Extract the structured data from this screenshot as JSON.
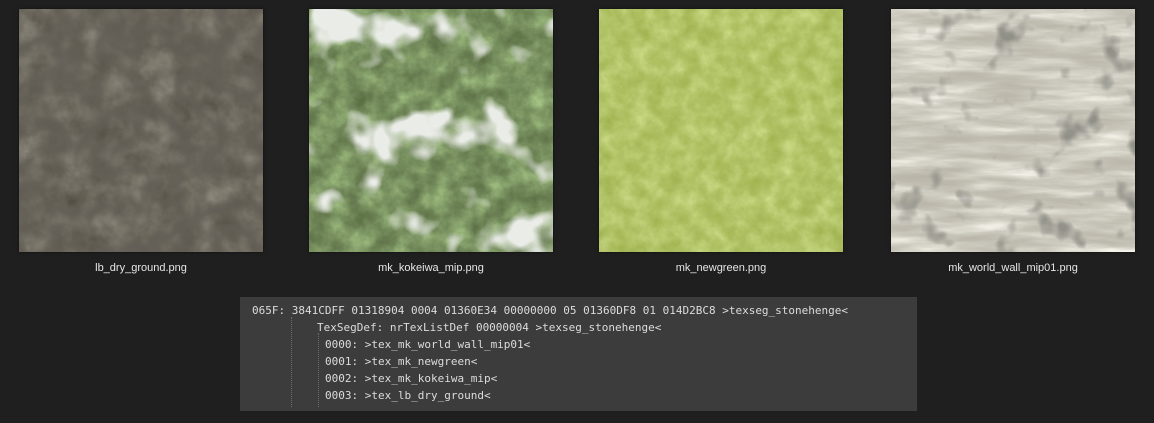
{
  "thumbnails": [
    {
      "filename": "lb_dry_ground.png",
      "kind": "dry-ground-texture",
      "color": "#5a5447"
    },
    {
      "filename": "mk_kokeiwa_mip.png",
      "kind": "mossy-rock-texture",
      "color": "#5e7448"
    },
    {
      "filename": "mk_newgreen.png",
      "kind": "grass-texture",
      "color": "#a3b54f"
    },
    {
      "filename": "mk_world_wall_mip01.png",
      "kind": "stone-wall-texture",
      "color": "#b8b4a8"
    }
  ],
  "code": {
    "header": "065F: 3841CDFF 01318904 0004 01360E34 00000000 05 01360DF8 01 014D2BC8 >texseg_stonehenge<",
    "texsegdef": "TexSegDef: nrTexListDef 00000004 >texseg_stonehenge<",
    "entries": [
      "0000: >tex_mk_world_wall_mip01<",
      "0001: >tex_mk_newgreen<",
      "0002: >tex_mk_kokeiwa_mip<",
      "0003: >tex_lb_dry_ground<"
    ]
  }
}
